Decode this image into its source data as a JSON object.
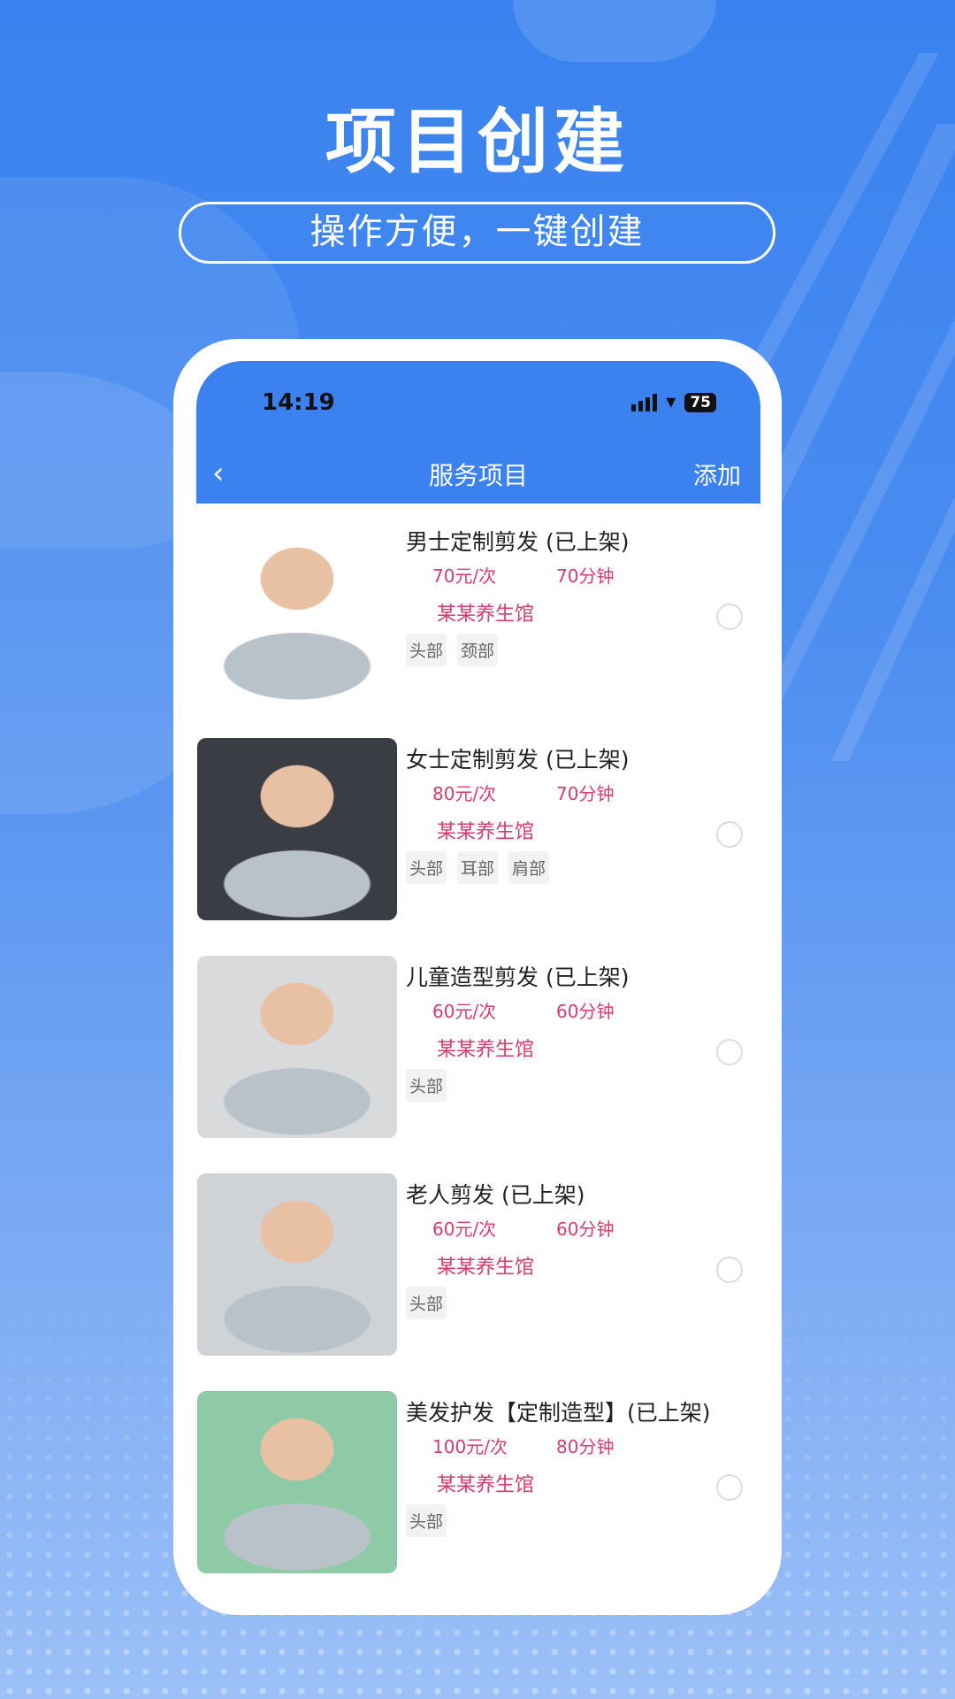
{
  "hero": {
    "title": "项目创建",
    "subtitle": "操作方便，一键创建"
  },
  "status": {
    "time": "14:19",
    "battery": "75"
  },
  "nav": {
    "back_icon": "chevron-left-icon",
    "title": "服务项目",
    "add_label": "添加"
  },
  "colors": {
    "brand": "#3b82f0",
    "accent": "#d63c6c"
  },
  "items": [
    {
      "title": "男士定制剪发 (已上架)",
      "price": "70元/次",
      "duration": "70分钟",
      "store": "某某养生馆",
      "tags": [
        "头部",
        "颈部"
      ],
      "image_bg": "#ffffff",
      "selected": false
    },
    {
      "title": "女士定制剪发 (已上架)",
      "price": "80元/次",
      "duration": "70分钟",
      "store": "某某养生馆",
      "tags": [
        "头部",
        "耳部",
        "肩部"
      ],
      "image_bg": "#3a3d44",
      "selected": false
    },
    {
      "title": "儿童造型剪发 (已上架)",
      "price": "60元/次",
      "duration": "60分钟",
      "store": "某某养生馆",
      "tags": [
        "头部"
      ],
      "image_bg": "#d9dadc",
      "selected": false
    },
    {
      "title": "老人剪发 (已上架)",
      "price": "60元/次",
      "duration": "60分钟",
      "store": "某某养生馆",
      "tags": [
        "头部"
      ],
      "image_bg": "#cfd3d6",
      "selected": false
    },
    {
      "title": "美发护发【定制造型】(已上架)",
      "price": "100元/次",
      "duration": "80分钟",
      "store": "某某养生馆",
      "tags": [
        "头部"
      ],
      "image_bg": "#8fcaa6",
      "selected": false
    }
  ]
}
